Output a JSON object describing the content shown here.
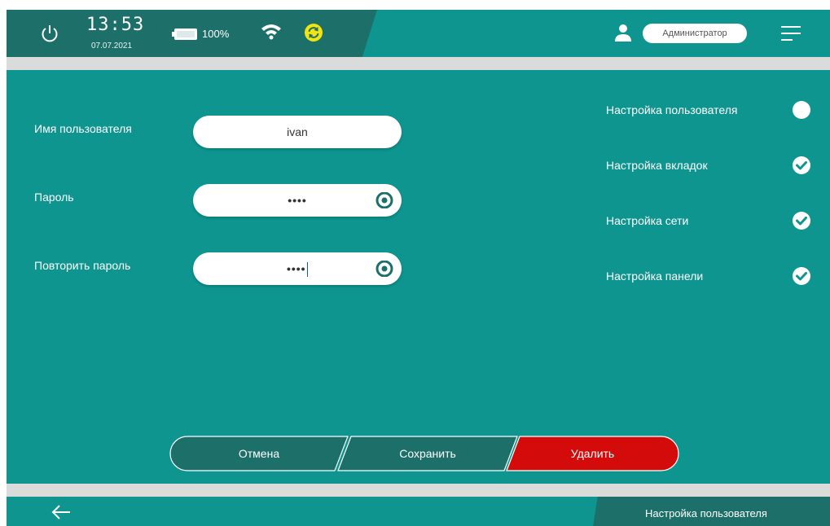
{
  "status_bar": {
    "time": "13:53",
    "date": "07.07.2021",
    "battery": "100%",
    "power_icon": "power-icon",
    "battery_icon": "battery-icon",
    "wifi_icon": "wifi-icon",
    "sync_icon": "sync-icon",
    "sync_color": "#f2e40f",
    "user_icon": "user-icon",
    "role": "Администратор",
    "menu_icon": "menu-icon"
  },
  "form": {
    "username": {
      "label": "Имя пользователя",
      "value": "ivan"
    },
    "password": {
      "label": "Пароль",
      "value": "••••",
      "eye_icon": "eye-icon"
    },
    "repeat_password": {
      "label": "Повторить пароль",
      "value": "••••",
      "eye_icon": "eye-icon"
    }
  },
  "permissions": [
    {
      "label": "Настройка пользователя",
      "enabled": false
    },
    {
      "label": "Настройка вкладок",
      "enabled": true
    },
    {
      "label": "Настройка сети",
      "enabled": true
    },
    {
      "label": "Настройка панели",
      "enabled": true
    }
  ],
  "actions": {
    "cancel": "Отмена",
    "save": "Сохранить",
    "delete": "Удалить"
  },
  "footer": {
    "back_icon": "back-arrow-icon",
    "title": "Настройка пользователя"
  },
  "colors": {
    "background": "#0e9590",
    "dark_teal": "#1d6f69",
    "delete": "#d40b0b",
    "divider": "#d9dcdb"
  }
}
